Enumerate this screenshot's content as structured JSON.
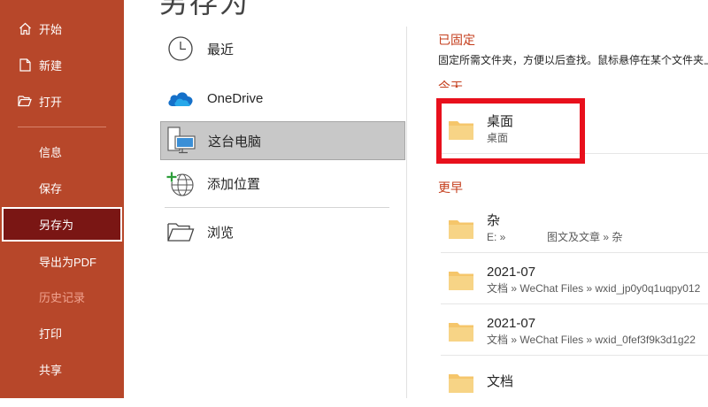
{
  "page_title": "另存为",
  "sidebar": {
    "items": [
      {
        "label": "开始",
        "icon": "home-icon"
      },
      {
        "label": "新建",
        "icon": "new-document-icon"
      },
      {
        "label": "打开",
        "icon": "open-folder-icon"
      },
      {
        "label": "信息"
      },
      {
        "label": "保存"
      },
      {
        "label": "另存为"
      },
      {
        "label": "导出为PDF"
      },
      {
        "label": "历史记录"
      },
      {
        "label": "打印"
      },
      {
        "label": "共享"
      }
    ]
  },
  "locations": {
    "items": [
      {
        "label": "最近",
        "icon": "clock-icon"
      },
      {
        "label": "OneDrive",
        "icon": "onedrive-cloud-icon"
      },
      {
        "label": "这台电脑",
        "icon": "this-pc-icon"
      },
      {
        "label": "添加位置",
        "icon": "add-location-globe-icon"
      },
      {
        "label": "浏览",
        "icon": "browse-folder-icon"
      }
    ]
  },
  "pinned": {
    "heading": "已固定",
    "description": "固定所需文件夹，方便以后查找。鼠标悬停在某个文件夹上"
  },
  "today": {
    "heading": "今天",
    "folders": [
      {
        "name": "桌面",
        "path": "桌面"
      }
    ]
  },
  "earlier": {
    "heading": "更早",
    "folders": [
      {
        "name": "杂",
        "path": "E: »              图文及文章 » 杂"
      },
      {
        "name": "2021-07",
        "path": "文档 » WeChat Files » wxid_jp0y0q1uqpy012"
      },
      {
        "name": "2021-07",
        "path": "文档 » WeChat Files » wxid_0fef3f9k3d1g22"
      },
      {
        "name": "文档",
        "path": ""
      }
    ]
  },
  "colors": {
    "sidebar_bg": "#b7472a",
    "sidebar_active_bg": "#7a1614",
    "accent_heading": "#c43e1c",
    "highlight_border": "#e8101c",
    "folder_fill": "#f5c66b"
  }
}
